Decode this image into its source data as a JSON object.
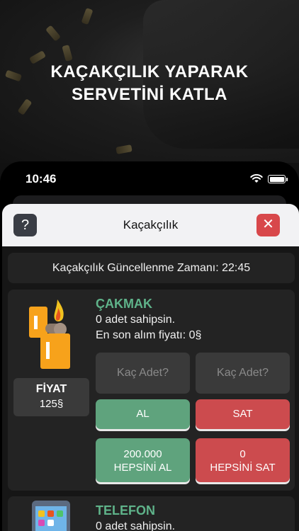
{
  "banner": {
    "headline_line1": "KAÇAKÇILIK YAPARAK",
    "headline_line2": "SERVETİNİ KATLA"
  },
  "status_bar": {
    "time": "10:46"
  },
  "sheet": {
    "help_label": "?",
    "title": "Kaçakçılık",
    "close_label": "✕"
  },
  "update_bar": {
    "text": "Kaçakçılık Güncellenme Zamanı: 22:45"
  },
  "items": [
    {
      "name": "ÇAKMAK",
      "owned_text": "0 adet sahipsin.",
      "last_price_text": "En son alım fiyatı: 0§",
      "price_label": "FİYAT",
      "price_value": "125§",
      "buy_qty_placeholder": "Kaç Adet?",
      "sell_qty_placeholder": "Kaç Adet?",
      "buy_label": "AL",
      "sell_label": "SAT",
      "buy_all_amount": "200.000",
      "buy_all_label": "HEPSİNİ AL",
      "sell_all_amount": "0",
      "sell_all_label": "HEPSİNİ SAT",
      "icon": "lighter-icon"
    },
    {
      "name": "TELEFON",
      "owned_text": "0 adet sahipsin.",
      "icon": "phone-icon"
    }
  ],
  "colors": {
    "accent_green": "#5fa37d",
    "item_name_green": "#5fb38a",
    "danger_red": "#cc4b4e",
    "card_bg": "#232323"
  }
}
